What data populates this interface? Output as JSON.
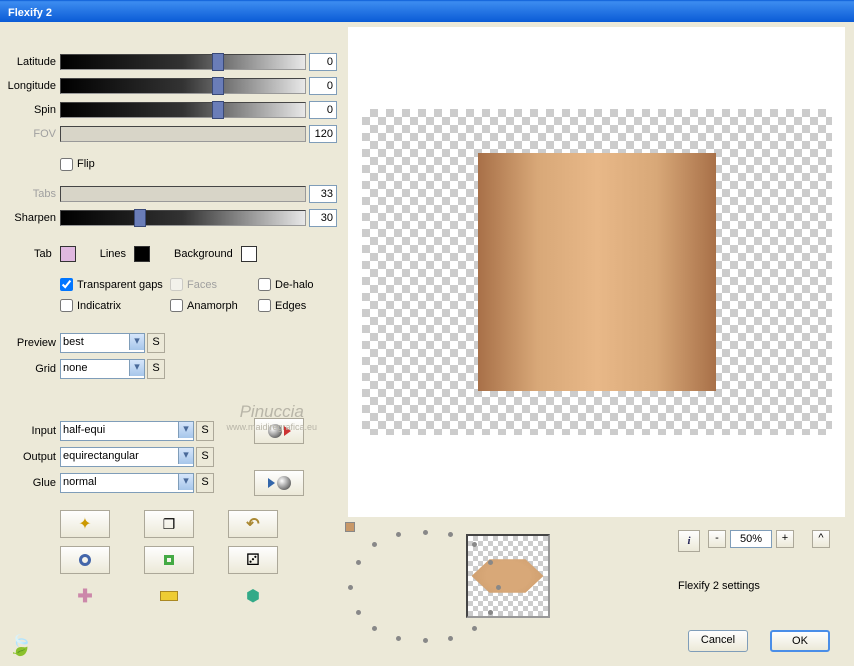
{
  "title": "Flexify 2",
  "sliders": {
    "latitude": {
      "label": "Latitude",
      "value": "0",
      "thumb": 62,
      "disabled": false
    },
    "longitude": {
      "label": "Longitude",
      "value": "0",
      "thumb": 62,
      "disabled": false
    },
    "spin": {
      "label": "Spin",
      "value": "0",
      "thumb": 62,
      "disabled": false
    },
    "fov": {
      "label": "FOV",
      "value": "120",
      "thumb": null,
      "disabled": true
    },
    "tabs": {
      "label": "Tabs",
      "value": "33",
      "thumb": null,
      "disabled": true
    },
    "sharpen": {
      "label": "Sharpen",
      "value": "30",
      "thumb": 30,
      "disabled": false
    }
  },
  "flip": {
    "label": "Flip",
    "checked": false
  },
  "colors": {
    "tab": {
      "label": "Tab",
      "color": "#e0b8e0"
    },
    "lines": {
      "label": "Lines",
      "color": "#000000"
    },
    "bg": {
      "label": "Background",
      "color": "#ffffff"
    }
  },
  "checks": {
    "transparent": {
      "label": "Transparent gaps",
      "checked": true
    },
    "faces": {
      "label": "Faces",
      "checked": false,
      "disabled": true
    },
    "dehalo": {
      "label": "De-halo",
      "checked": false
    },
    "indicatrix": {
      "label": "Indicatrix",
      "checked": false
    },
    "anamorph": {
      "label": "Anamorph",
      "checked": false
    },
    "edges": {
      "label": "Edges",
      "checked": false
    }
  },
  "selects": {
    "preview": {
      "label": "Preview",
      "value": "best"
    },
    "grid": {
      "label": "Grid",
      "value": "none"
    },
    "input": {
      "label": "Input",
      "value": "half-equi"
    },
    "output": {
      "label": "Output",
      "value": "equirectangular"
    },
    "glue": {
      "label": "Glue",
      "value": "normal"
    }
  },
  "watermark": {
    "line1": "Pinuccia",
    "line2": "www.maidiregrafica.eu"
  },
  "zoom": {
    "minus": "-",
    "plus": "+",
    "value": "50%"
  },
  "caret": "^",
  "status": "Flexify 2 settings",
  "buttons": {
    "cancel": "Cancel",
    "ok": "OK"
  },
  "info": "i",
  "reset": "S"
}
